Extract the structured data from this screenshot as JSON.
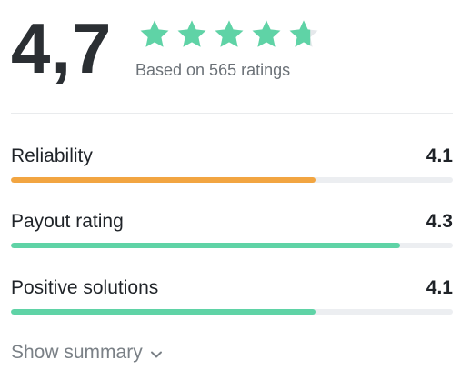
{
  "rating": {
    "score": "4,7",
    "stars_value": 4.7,
    "stars_max": 5,
    "based_on": "Based on 565 ratings"
  },
  "metrics": [
    {
      "label": "Reliability",
      "value": "4.1",
      "fraction": 0.69,
      "color": "#f2a541"
    },
    {
      "label": "Payout rating",
      "value": "4.3",
      "fraction": 0.88,
      "color": "#5fd3a6"
    },
    {
      "label": "Positive solutions",
      "value": "4.1",
      "fraction": 0.69,
      "color": "#5fd3a6"
    }
  ],
  "actions": {
    "show_summary": "Show summary"
  },
  "colors": {
    "star_fill": "#5fd3a6",
    "star_empty": "#e5e8eb"
  },
  "icons": {
    "star": "star-icon",
    "chevron": "chevron-down-icon"
  }
}
